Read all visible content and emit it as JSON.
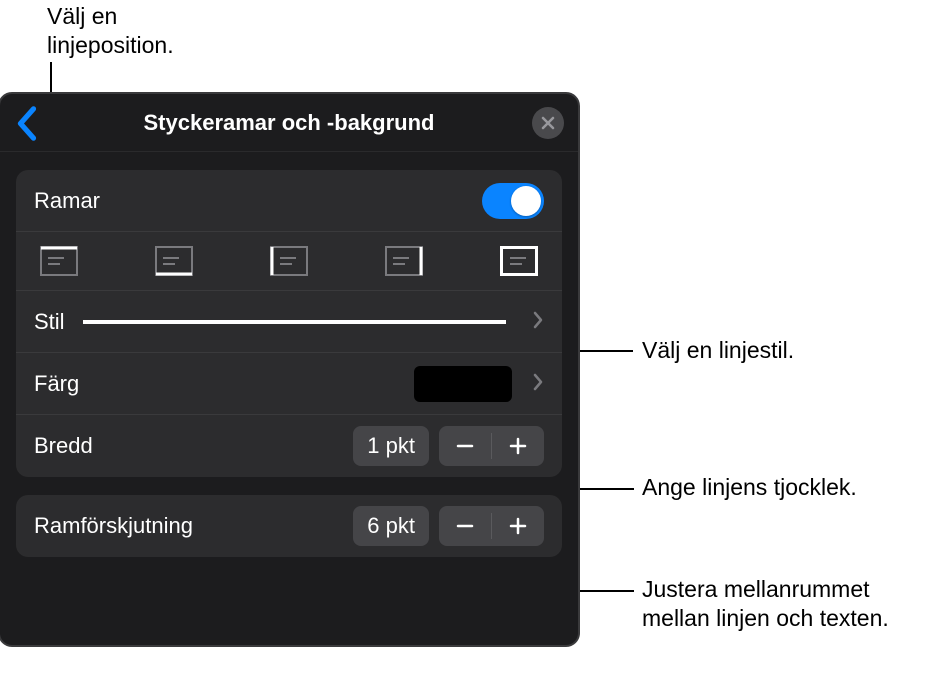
{
  "callouts": {
    "position": "Välj en linjeposition.",
    "style": "Välj en linjestil.",
    "width": "Ange linjens tjocklek.",
    "offset": "Justera mellanrummet mellan linjen och texten."
  },
  "panel": {
    "title": "Styckeramar och -bakgrund",
    "rows": {
      "borders_label": "Ramar",
      "style_label": "Stil",
      "color_label": "Färg",
      "width_label": "Bredd",
      "width_value": "1 pkt",
      "offset_label": "Ramförskjutning",
      "offset_value": "6 pkt"
    },
    "toggle_on": true,
    "positions": [
      "top",
      "bottom",
      "left",
      "right",
      "all"
    ],
    "color_value": "#000000"
  }
}
